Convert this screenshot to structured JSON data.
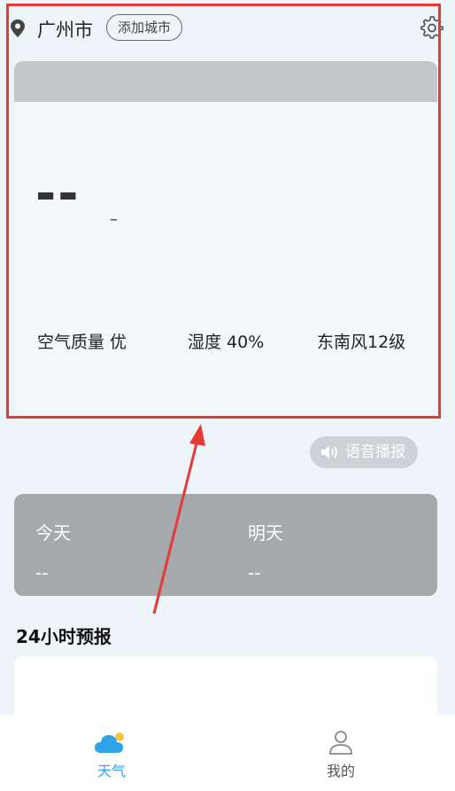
{
  "header": {
    "city": "广州市",
    "add_city_label": "添加城市"
  },
  "weather": {
    "temperature": "--",
    "unit": "–",
    "air_quality": "空气质量  优",
    "humidity": "湿度  40%",
    "wind": "东南风12级"
  },
  "voice": {
    "label": "语音播报"
  },
  "days": [
    {
      "label": "今天",
      "value": "--"
    },
    {
      "label": "明天",
      "value": "--"
    }
  ],
  "forecast": {
    "title": "24小时预报"
  },
  "nav": [
    {
      "label": "天气",
      "icon": "cloud-sun-icon",
      "active": true
    },
    {
      "label": "我的",
      "icon": "person-icon",
      "active": false
    }
  ],
  "colors": {
    "accent": "#2ea3e8",
    "highlight": "#e53935"
  }
}
